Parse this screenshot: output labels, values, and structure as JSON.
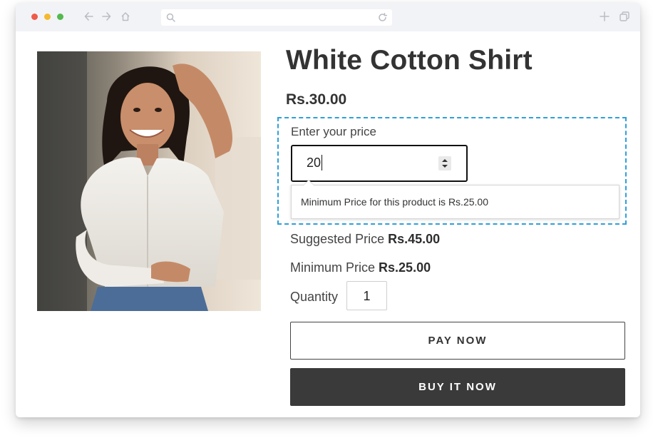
{
  "browser": {
    "colors": {
      "close": "#ee5b49",
      "minimize": "#f4b92e",
      "maximize": "#54b94e"
    },
    "icons": [
      "back-arrow-icon",
      "forward-arrow-icon",
      "home-icon",
      "search-icon",
      "reload-icon",
      "new-tab-plus-icon",
      "copy-tabs-icon"
    ]
  },
  "product": {
    "image_description": "product-photo",
    "title": "White Cotton Shirt",
    "price": "Rs.30.00",
    "price_entry": {
      "label": "Enter your price",
      "value": "20",
      "tooltip": "Minimum Price for this product is Rs.25.00"
    },
    "suggested_label": "Suggested Price",
    "suggested_value": "Rs.45.00",
    "minimum_label": "Minimum Price",
    "minimum_value": "Rs.25.00",
    "quantity_label": "Quantity",
    "quantity_value": "1",
    "pay_now_label": "PAY NOW",
    "buy_now_label": "BUY IT NOW"
  },
  "colors": {
    "highlight_border": "#2f9fd8",
    "buy_button_bg": "#3a3a3a",
    "text_dark": "#333333"
  }
}
